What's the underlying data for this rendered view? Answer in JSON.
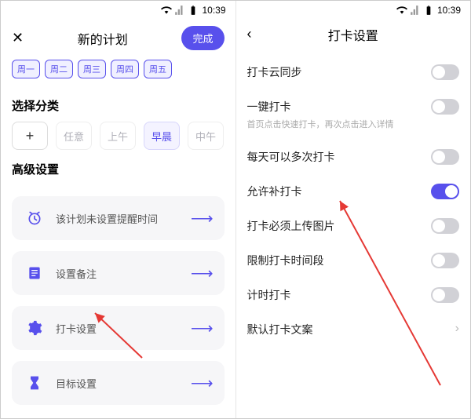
{
  "status": {
    "time": "10:39"
  },
  "left": {
    "title": "新的计划",
    "done": "完成",
    "days": [
      "周一",
      "周二",
      "周三",
      "周四",
      "周五"
    ],
    "section_category": "选择分类",
    "categories": {
      "any": "任意",
      "morning": "上午",
      "early": "早晨",
      "noon": "中午"
    },
    "section_advanced": "高级设置",
    "adv": {
      "reminder": "该计划未设置提醒时间",
      "note": "设置备注",
      "checkin": "打卡设置",
      "goal": "目标设置"
    }
  },
  "right": {
    "title": "打卡设置",
    "items": {
      "cloud": "打卡云同步",
      "oneclick": "一键打卡",
      "oneclick_sub": "首页点击快速打卡，再次点击进入详情",
      "multiple": "每天可以多次打卡",
      "makeup": "允许补打卡",
      "photo": "打卡必须上传图片",
      "limit_time": "限制打卡时间段",
      "timer": "计时打卡",
      "default_text": "默认打卡文案"
    }
  }
}
